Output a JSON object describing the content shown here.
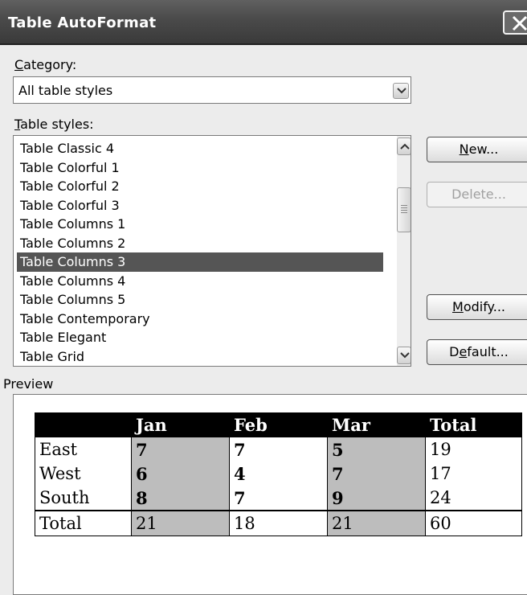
{
  "window": {
    "title": "Table AutoFormat"
  },
  "category": {
    "label_prefix": "",
    "label_underline": "C",
    "label_rest": "ategory:",
    "value": "All table styles"
  },
  "styles": {
    "label_underline": "T",
    "label_rest": "able styles:",
    "items": [
      "Table Classic 4",
      "Table Colorful 1",
      "Table Colorful 2",
      "Table Colorful 3",
      "Table Columns 1",
      "Table Columns 2",
      "Table Columns 3",
      "Table Columns 4",
      "Table Columns 5",
      "Table Contemporary",
      "Table Elegant",
      "Table Grid"
    ],
    "selected": "Table Columns 3"
  },
  "buttons": {
    "new": {
      "underline": "N",
      "rest": "ew..."
    },
    "delete": {
      "label": "Delete..."
    },
    "modify": {
      "underline": "M",
      "rest": "odify..."
    },
    "default": {
      "pre": "D",
      "underline": "e",
      "rest": "fault..."
    }
  },
  "preview": {
    "label": "Preview",
    "header": [
      "",
      "Jan",
      "Feb",
      "Mar",
      "Total"
    ],
    "rows": [
      [
        "East",
        "7",
        "7",
        "5",
        "19"
      ],
      [
        "West",
        "6",
        "4",
        "7",
        "17"
      ],
      [
        "South",
        "8",
        "7",
        "9",
        "24"
      ]
    ],
    "total_row": [
      "Total",
      "21",
      "18",
      "21",
      "60"
    ]
  },
  "colors": {
    "title_bar": "#4a4a4a",
    "selection": "#555555",
    "shade": "#bdbdbd",
    "header_fill": "#000000"
  }
}
